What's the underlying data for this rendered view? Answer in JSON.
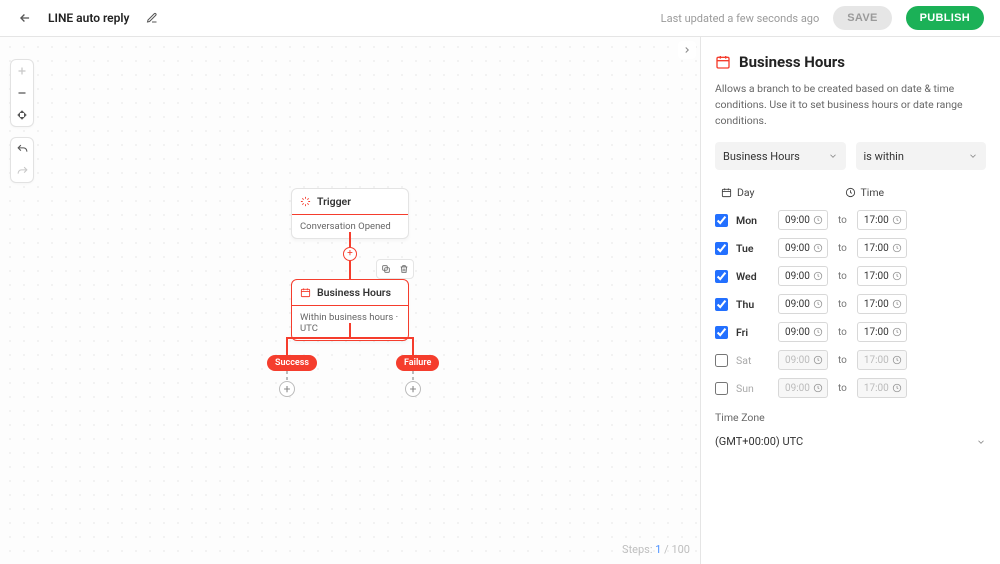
{
  "header": {
    "title": "LINE auto reply",
    "last_updated": "Last updated a few seconds ago",
    "save_label": "SAVE",
    "publish_label": "PUBLISH"
  },
  "canvas": {
    "trigger": {
      "title": "Trigger",
      "subtitle": "Conversation Opened"
    },
    "bh_node": {
      "title": "Business Hours",
      "subtitle": "Within business hours · UTC"
    },
    "success_label": "Success",
    "failure_label": "Failure",
    "steps_label": "Steps:",
    "steps_current": "1",
    "steps_total": "/ 100"
  },
  "panel": {
    "title": "Business Hours",
    "description": "Allows a branch to be created based on date & time conditions. Use it to set business hours or date range conditions.",
    "select_mode": "Business Hours",
    "select_cond": "is within",
    "col_day_label": "Day",
    "col_time_label": "Time",
    "to_label": "to",
    "days": [
      {
        "name": "Mon",
        "enabled": true,
        "start": "09:00",
        "end": "17:00"
      },
      {
        "name": "Tue",
        "enabled": true,
        "start": "09:00",
        "end": "17:00"
      },
      {
        "name": "Wed",
        "enabled": true,
        "start": "09:00",
        "end": "17:00"
      },
      {
        "name": "Thu",
        "enabled": true,
        "start": "09:00",
        "end": "17:00"
      },
      {
        "name": "Fri",
        "enabled": true,
        "start": "09:00",
        "end": "17:00"
      },
      {
        "name": "Sat",
        "enabled": false,
        "start": "09:00",
        "end": "17:00"
      },
      {
        "name": "Sun",
        "enabled": false,
        "start": "09:00",
        "end": "17:00"
      }
    ],
    "timezone_label": "Time Zone",
    "timezone_value": "(GMT+00:00) UTC"
  }
}
